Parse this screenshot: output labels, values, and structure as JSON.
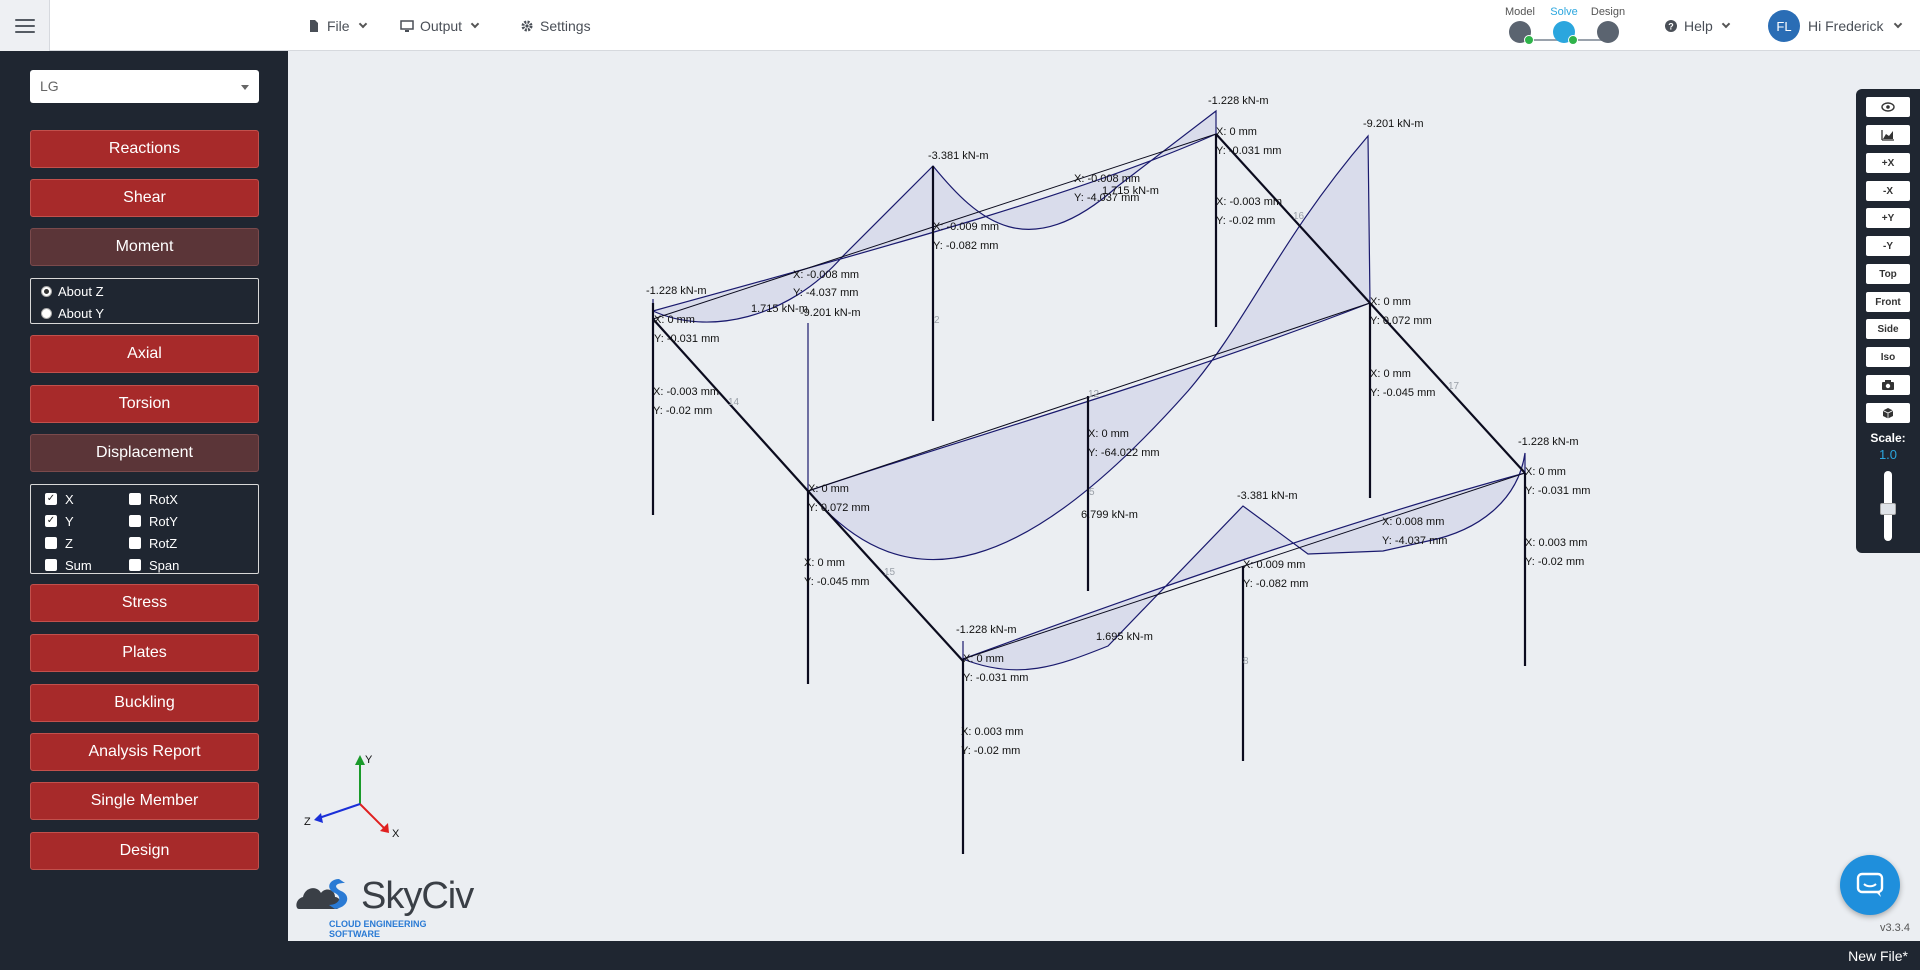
{
  "topbar": {
    "menu": [
      {
        "label": "File",
        "icon": "file-icon"
      },
      {
        "label": "Output",
        "icon": "monitor-icon"
      },
      {
        "label": "Settings",
        "icon": "gear-icon"
      }
    ],
    "steps": [
      {
        "label": "Model"
      },
      {
        "label": "Solve"
      },
      {
        "label": "Design"
      }
    ],
    "help_label": "Help",
    "user_initials": "FL",
    "user_greeting": "Hi Frederick"
  },
  "sidebar": {
    "combo_value": "LG",
    "buttons": {
      "reactions": "Reactions",
      "shear": "Shear",
      "moment": "Moment",
      "axial": "Axial",
      "torsion": "Torsion",
      "displacement": "Displacement",
      "stress": "Stress",
      "plates": "Plates",
      "buckling": "Buckling",
      "analysis_report": "Analysis Report",
      "single_member": "Single Member",
      "design": "Design"
    },
    "moment_options": [
      {
        "label": "About Z",
        "selected": true
      },
      {
        "label": "About Y",
        "selected": false
      }
    ],
    "displacement_options": [
      {
        "label": "X",
        "checked": true
      },
      {
        "label": "RotX",
        "checked": false
      },
      {
        "label": "Y",
        "checked": true
      },
      {
        "label": "RotY",
        "checked": false
      },
      {
        "label": "Z",
        "checked": false
      },
      {
        "label": "RotZ",
        "checked": false
      },
      {
        "label": "Sum",
        "checked": false
      },
      {
        "label": "Span",
        "checked": false
      }
    ]
  },
  "viewbar": {
    "buttons": [
      "+X",
      "-X",
      "+Y",
      "-Y",
      "Top",
      "Front",
      "Side",
      "Iso"
    ],
    "scale_label": "Scale:",
    "scale_value": "1.0"
  },
  "axes": {
    "x": "X",
    "y": "Y",
    "z": "Z"
  },
  "logo": {
    "name": "SkyCiv",
    "tagline": "CLOUD ENGINEERING SOFTWARE"
  },
  "version": "v3.3.4",
  "file_name": "New File*",
  "colors": {
    "accent": "#2ba6de",
    "button": "#a72a2a",
    "sidebar": "#1f2631",
    "diagram": "#1a1a6e",
    "fill": "#d6d8ea"
  },
  "model_labels": [
    "-1.228 kN-m",
    "-3.381 kN-m",
    "-1.228 kN-m",
    "-9.201 kN-m",
    "X: 0 mm",
    "Y: -0.031 mm",
    "X: -0.003 mm",
    "Y: -0.02 mm",
    "1.715 kN-m",
    "-9.201 kN-m",
    "X: -0.008 mm",
    "Y: -4.037 mm",
    "X: -0.009 mm",
    "Y: -0.082 mm",
    "X: -0.008 mm",
    "Y: -4.037 mm",
    "1.715 kN-m",
    "X: 0 mm",
    "Y: -0.031 mm",
    "X: -0.003 mm",
    "Y: -0.02 mm",
    "X: 0 mm",
    "Y: 0.072 mm",
    "X: 0 mm",
    "Y: -0.045 mm",
    "X: 0 mm",
    "Y: -64.022 mm",
    "6.799 kN-m",
    "X: 0 mm",
    "Y: 0.072 mm",
    "X: 0 mm",
    "Y: -0.045 mm",
    "-1.228 kN-m",
    "X: 0 mm",
    "Y: -0.031 mm",
    "X: 0.003 mm",
    "Y: -0.02 mm",
    "-3.381 kN-m",
    "X: 0.009 mm",
    "Y: -0.082 mm",
    "X: 0.008 mm",
    "Y: -4.037 mm",
    "1.695 kN-m",
    "-1.228 kN-m",
    "X: 0 mm",
    "Y: -0.031 mm",
    "X: 0.003 mm",
    "Y: -0.02 mm"
  ],
  "member_numbers": [
    "14",
    "16",
    "17",
    "15",
    "12",
    "2",
    "5",
    "8"
  ]
}
